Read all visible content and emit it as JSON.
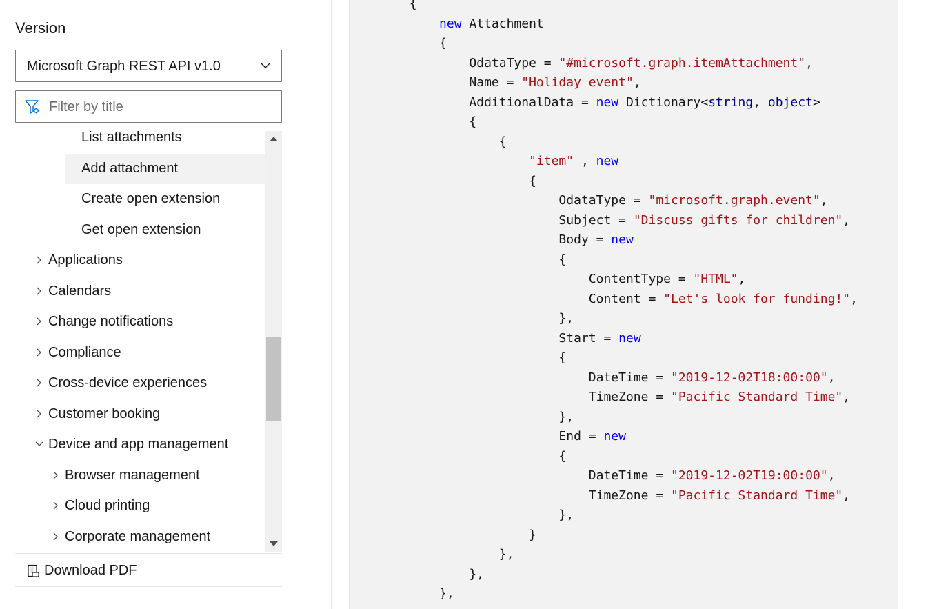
{
  "sidebar": {
    "version_label": "Version",
    "version_select": {
      "value": "Microsoft Graph REST API v1.0"
    },
    "filter": {
      "placeholder": "Filter by title"
    },
    "tree": [
      {
        "label": "List attachments",
        "level": 3,
        "expander": "none",
        "active": false
      },
      {
        "label": "Add attachment",
        "level": 3,
        "expander": "none",
        "active": true
      },
      {
        "label": "Create open extension",
        "level": 3,
        "expander": "none",
        "active": false
      },
      {
        "label": "Get open extension",
        "level": 3,
        "expander": "none",
        "active": false
      },
      {
        "label": "Applications",
        "level": 1,
        "expander": "collapsed",
        "active": false
      },
      {
        "label": "Calendars",
        "level": 1,
        "expander": "collapsed",
        "active": false
      },
      {
        "label": "Change notifications",
        "level": 1,
        "expander": "collapsed",
        "active": false
      },
      {
        "label": "Compliance",
        "level": 1,
        "expander": "collapsed",
        "active": false
      },
      {
        "label": "Cross-device experiences",
        "level": 1,
        "expander": "collapsed",
        "active": false
      },
      {
        "label": "Customer booking",
        "level": 1,
        "expander": "collapsed",
        "active": false
      },
      {
        "label": "Device and app management",
        "level": 1,
        "expander": "expanded",
        "active": false
      },
      {
        "label": "Browser management",
        "level": 2,
        "expander": "collapsed",
        "active": false
      },
      {
        "label": "Cloud printing",
        "level": 2,
        "expander": "collapsed",
        "active": false
      },
      {
        "label": "Corporate management",
        "level": 2,
        "expander": "collapsed",
        "active": false
      }
    ],
    "download_pdf_label": "Download PDF",
    "scrollbar": {
      "scroll_position": 0.55
    }
  },
  "code": {
    "language": "csharp",
    "colors": {
      "keyword": "#0101fd",
      "type_keyword": "#00008a",
      "string": "#a31515",
      "background": "#f2f2f2"
    },
    "lines": [
      [
        [
          "p",
          "        {"
        ]
      ],
      [
        [
          "k",
          "            new"
        ],
        [
          "p",
          " Attachment"
        ]
      ],
      [
        [
          "p",
          "            {"
        ]
      ],
      [
        [
          "p",
          "                OdataType = "
        ],
        [
          "s",
          "\"#microsoft.graph.itemAttachment\""
        ],
        [
          "p",
          ","
        ]
      ],
      [
        [
          "p",
          "                Name = "
        ],
        [
          "s",
          "\"Holiday event\""
        ],
        [
          "p",
          ","
        ]
      ],
      [
        [
          "p",
          "                AdditionalData = "
        ],
        [
          "k",
          "new"
        ],
        [
          "p",
          " Dictionary<"
        ],
        [
          "t",
          "string"
        ],
        [
          "p",
          ", "
        ],
        [
          "t",
          "object"
        ],
        [
          "p",
          ">"
        ]
      ],
      [
        [
          "p",
          "                {"
        ]
      ],
      [
        [
          "p",
          "                    {"
        ]
      ],
      [
        [
          "s",
          "                        \"item\""
        ],
        [
          "p",
          " , "
        ],
        [
          "k",
          "new"
        ]
      ],
      [
        [
          "p",
          "                        {"
        ]
      ],
      [
        [
          "p",
          "                            OdataType = "
        ],
        [
          "s",
          "\"microsoft.graph.event\""
        ],
        [
          "p",
          ","
        ]
      ],
      [
        [
          "p",
          "                            Subject = "
        ],
        [
          "s",
          "\"Discuss gifts for children\""
        ],
        [
          "p",
          ","
        ]
      ],
      [
        [
          "p",
          "                            Body = "
        ],
        [
          "k",
          "new"
        ]
      ],
      [
        [
          "p",
          "                            {"
        ]
      ],
      [
        [
          "p",
          "                                ContentType = "
        ],
        [
          "s",
          "\"HTML\""
        ],
        [
          "p",
          ","
        ]
      ],
      [
        [
          "p",
          "                                Content = "
        ],
        [
          "s",
          "\"Let's look for funding!\""
        ],
        [
          "p",
          ","
        ]
      ],
      [
        [
          "p",
          "                            },"
        ]
      ],
      [
        [
          "p",
          "                            Start = "
        ],
        [
          "k",
          "new"
        ]
      ],
      [
        [
          "p",
          "                            {"
        ]
      ],
      [
        [
          "p",
          "                                DateTime = "
        ],
        [
          "s",
          "\"2019-12-02T18:00:00\""
        ],
        [
          "p",
          ","
        ]
      ],
      [
        [
          "p",
          "                                TimeZone = "
        ],
        [
          "s",
          "\"Pacific Standard Time\""
        ],
        [
          "p",
          ","
        ]
      ],
      [
        [
          "p",
          "                            },"
        ]
      ],
      [
        [
          "p",
          "                            End = "
        ],
        [
          "k",
          "new"
        ]
      ],
      [
        [
          "p",
          "                            {"
        ]
      ],
      [
        [
          "p",
          "                                DateTime = "
        ],
        [
          "s",
          "\"2019-12-02T19:00:00\""
        ],
        [
          "p",
          ","
        ]
      ],
      [
        [
          "p",
          "                                TimeZone = "
        ],
        [
          "s",
          "\"Pacific Standard Time\""
        ],
        [
          "p",
          ","
        ]
      ],
      [
        [
          "p",
          "                            },"
        ]
      ],
      [
        [
          "p",
          "                        }"
        ]
      ],
      [
        [
          "p",
          "                    },"
        ]
      ],
      [
        [
          "p",
          "                },"
        ]
      ],
      [
        [
          "p",
          "            },"
        ]
      ]
    ]
  }
}
